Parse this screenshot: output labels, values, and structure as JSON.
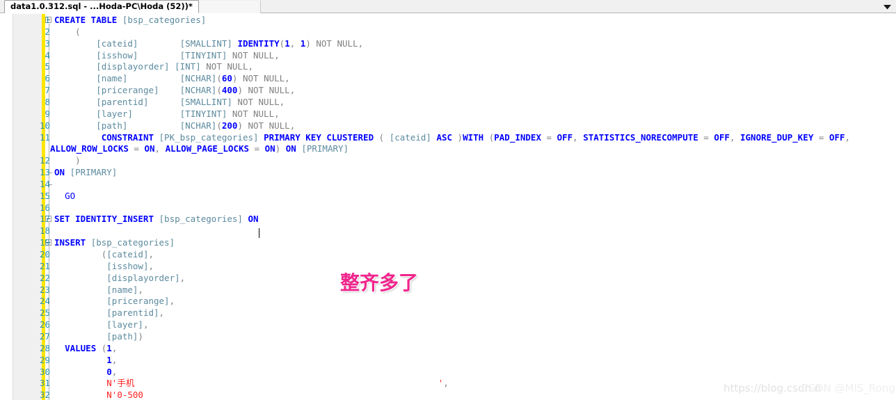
{
  "window": {
    "tab_title": "data1.0.312.sql - ...Hoda-PC\\Hoda (52))*",
    "tab_dropdown_icon": "chevron-down-icon"
  },
  "editor": {
    "language": "sql",
    "caret_line": 17,
    "first_visible_line": 1,
    "last_visible_line": 32,
    "colors": {
      "keyword": "#0000ff",
      "identifier": "#5b8a9e",
      "string": "#ff2020",
      "plain": "#808080",
      "line_number": "#2b91af",
      "change_bar": "#ffe600",
      "background": "#ffffff",
      "gutter": "#f0f0f0"
    },
    "lines": [
      {
        "n": 1,
        "fold": "start",
        "tokens": [
          {
            "t": "CREATE TABLE ",
            "c": "kw"
          },
          {
            "t": "[bsp_categories]",
            "c": "id"
          }
        ]
      },
      {
        "n": 2,
        "tokens": [
          {
            "t": "    (",
            "c": "pl"
          }
        ]
      },
      {
        "n": 3,
        "tokens": [
          {
            "t": "        ",
            "c": "pl"
          },
          {
            "t": "[cateid]",
            "c": "id"
          },
          {
            "t": "        ",
            "c": "pl"
          },
          {
            "t": "[SMALLINT]",
            "c": "id"
          },
          {
            "t": " ",
            "c": "pl"
          },
          {
            "t": "IDENTITY",
            "c": "kw"
          },
          {
            "t": "(",
            "c": "pl"
          },
          {
            "t": "1",
            "c": "num"
          },
          {
            "t": ", ",
            "c": "pl"
          },
          {
            "t": "1",
            "c": "num"
          },
          {
            "t": ") NOT NULL,",
            "c": "pl"
          }
        ]
      },
      {
        "n": 4,
        "tokens": [
          {
            "t": "        ",
            "c": "pl"
          },
          {
            "t": "[isshow]",
            "c": "id"
          },
          {
            "t": "        ",
            "c": "pl"
          },
          {
            "t": "[TINYINT]",
            "c": "id"
          },
          {
            "t": " NOT NULL,",
            "c": "pl"
          }
        ]
      },
      {
        "n": 5,
        "tokens": [
          {
            "t": "        ",
            "c": "pl"
          },
          {
            "t": "[displayorder]",
            "c": "id"
          },
          {
            "t": " ",
            "c": "pl"
          },
          {
            "t": "[INT]",
            "c": "id"
          },
          {
            "t": " NOT NULL,",
            "c": "pl"
          }
        ]
      },
      {
        "n": 6,
        "tokens": [
          {
            "t": "        ",
            "c": "pl"
          },
          {
            "t": "[name]",
            "c": "id"
          },
          {
            "t": "          ",
            "c": "pl"
          },
          {
            "t": "[NCHAR]",
            "c": "id"
          },
          {
            "t": "(",
            "c": "pl"
          },
          {
            "t": "60",
            "c": "num"
          },
          {
            "t": ") NOT NULL,",
            "c": "pl"
          }
        ]
      },
      {
        "n": 7,
        "tokens": [
          {
            "t": "        ",
            "c": "pl"
          },
          {
            "t": "[pricerange]",
            "c": "id"
          },
          {
            "t": "    ",
            "c": "pl"
          },
          {
            "t": "[NCHAR]",
            "c": "id"
          },
          {
            "t": "(",
            "c": "pl"
          },
          {
            "t": "400",
            "c": "num"
          },
          {
            "t": ") NOT NULL,",
            "c": "pl"
          }
        ]
      },
      {
        "n": 8,
        "tokens": [
          {
            "t": "        ",
            "c": "pl"
          },
          {
            "t": "[parentid]",
            "c": "id"
          },
          {
            "t": "      ",
            "c": "pl"
          },
          {
            "t": "[SMALLINT]",
            "c": "id"
          },
          {
            "t": " NOT NULL,",
            "c": "pl"
          }
        ]
      },
      {
        "n": 9,
        "tokens": [
          {
            "t": "        ",
            "c": "pl"
          },
          {
            "t": "[layer]",
            "c": "id"
          },
          {
            "t": "         ",
            "c": "pl"
          },
          {
            "t": "[TINYINT]",
            "c": "id"
          },
          {
            "t": " NOT NULL,",
            "c": "pl"
          }
        ]
      },
      {
        "n": 10,
        "tokens": [
          {
            "t": "        ",
            "c": "pl"
          },
          {
            "t": "[path]",
            "c": "id"
          },
          {
            "t": "          ",
            "c": "pl"
          },
          {
            "t": "[NCHAR]",
            "c": "id"
          },
          {
            "t": "(",
            "c": "pl"
          },
          {
            "t": "200",
            "c": "num"
          },
          {
            "t": ") NOT NULL,",
            "c": "pl"
          }
        ]
      },
      {
        "n": 11,
        "tokens": [
          {
            "t": "         ",
            "c": "pl"
          },
          {
            "t": "CONSTRAINT ",
            "c": "kw"
          },
          {
            "t": "[PK_bsp_categories]",
            "c": "id"
          },
          {
            "t": " ",
            "c": "pl"
          },
          {
            "t": "PRIMARY KEY CLUSTERED",
            "c": "kw"
          },
          {
            "t": " ( ",
            "c": "pl"
          },
          {
            "t": "[cateid]",
            "c": "id"
          },
          {
            "t": " ",
            "c": "pl"
          },
          {
            "t": "ASC",
            "c": "kw"
          },
          {
            "t": " )",
            "c": "pl"
          },
          {
            "t": "WITH",
            "c": "kw"
          },
          {
            "t": " (",
            "c": "pl"
          },
          {
            "t": "PAD_INDEX",
            "c": "kw"
          },
          {
            "t": " = ",
            "c": "pl"
          },
          {
            "t": "OFF",
            "c": "kw"
          },
          {
            "t": ", ",
            "c": "pl"
          },
          {
            "t": "STATISTICS_NORECOMPUTE",
            "c": "kw"
          },
          {
            "t": " = ",
            "c": "pl"
          },
          {
            "t": "OFF",
            "c": "kw"
          },
          {
            "t": ", ",
            "c": "pl"
          },
          {
            "t": "IGNORE_DUP_KEY",
            "c": "kw"
          },
          {
            "t": " = ",
            "c": "pl"
          },
          {
            "t": "OFF",
            "c": "kw"
          },
          {
            "t": ",",
            "c": "pl"
          }
        ]
      },
      {
        "n": null,
        "wrap": true,
        "tokens": [
          {
            "t": "ALLOW_ROW_LOCKS",
            "c": "kw"
          },
          {
            "t": " = ",
            "c": "pl"
          },
          {
            "t": "ON",
            "c": "kw"
          },
          {
            "t": ", ",
            "c": "pl"
          },
          {
            "t": "ALLOW_PAGE_LOCKS",
            "c": "kw"
          },
          {
            "t": " = ",
            "c": "pl"
          },
          {
            "t": "ON",
            "c": "kw"
          },
          {
            "t": ") ",
            "c": "pl"
          },
          {
            "t": "ON",
            "c": "kw"
          },
          {
            "t": " ",
            "c": "pl"
          },
          {
            "t": "[PRIMARY]",
            "c": "id"
          }
        ]
      },
      {
        "n": 12,
        "tokens": [
          {
            "t": "    )",
            "c": "pl"
          }
        ]
      },
      {
        "n": 13,
        "fold": "mid",
        "tokens": [
          {
            "t": "ON",
            "c": "kw"
          },
          {
            "t": " ",
            "c": "pl"
          },
          {
            "t": "[PRIMARY]",
            "c": "id"
          }
        ]
      },
      {
        "n": 14,
        "fold": "end",
        "tokens": [
          {
            "t": "",
            "c": "pl"
          }
        ]
      },
      {
        "n": 15,
        "tokens": [
          {
            "t": "  ",
            "c": "pl"
          },
          {
            "t": "GO",
            "c": "kw2"
          }
        ]
      },
      {
        "n": 16,
        "tokens": [
          {
            "t": "",
            "c": "pl"
          }
        ]
      },
      {
        "n": 17,
        "fold": "start",
        "tokens": [
          {
            "t": "SET IDENTITY_INSERT",
            "c": "kw"
          },
          {
            "t": " ",
            "c": "pl"
          },
          {
            "t": "[bsp_categories]",
            "c": "id"
          },
          {
            "t": " ",
            "c": "pl"
          },
          {
            "t": "ON",
            "c": "kw"
          }
        ]
      },
      {
        "n": 18,
        "tokens": [
          {
            "t": "",
            "c": "pl"
          }
        ]
      },
      {
        "n": 19,
        "fold": "start",
        "tokens": [
          {
            "t": "INSERT",
            "c": "kw"
          },
          {
            "t": " ",
            "c": "pl"
          },
          {
            "t": "[bsp_categories]",
            "c": "id"
          }
        ]
      },
      {
        "n": 20,
        "tokens": [
          {
            "t": "         (",
            "c": "pl"
          },
          {
            "t": "[cateid]",
            "c": "id"
          },
          {
            "t": ",",
            "c": "pl"
          }
        ]
      },
      {
        "n": 21,
        "tokens": [
          {
            "t": "          ",
            "c": "pl"
          },
          {
            "t": "[isshow]",
            "c": "id"
          },
          {
            "t": ",",
            "c": "pl"
          }
        ]
      },
      {
        "n": 22,
        "tokens": [
          {
            "t": "          ",
            "c": "pl"
          },
          {
            "t": "[displayorder]",
            "c": "id"
          },
          {
            "t": ",",
            "c": "pl"
          }
        ]
      },
      {
        "n": 23,
        "tokens": [
          {
            "t": "          ",
            "c": "pl"
          },
          {
            "t": "[name]",
            "c": "id"
          },
          {
            "t": ",",
            "c": "pl"
          }
        ]
      },
      {
        "n": 24,
        "tokens": [
          {
            "t": "          ",
            "c": "pl"
          },
          {
            "t": "[pricerange]",
            "c": "id"
          },
          {
            "t": ",",
            "c": "pl"
          }
        ]
      },
      {
        "n": 25,
        "tokens": [
          {
            "t": "          ",
            "c": "pl"
          },
          {
            "t": "[parentid]",
            "c": "id"
          },
          {
            "t": ",",
            "c": "pl"
          }
        ]
      },
      {
        "n": 26,
        "tokens": [
          {
            "t": "          ",
            "c": "pl"
          },
          {
            "t": "[layer]",
            "c": "id"
          },
          {
            "t": ",",
            "c": "pl"
          }
        ]
      },
      {
        "n": 27,
        "tokens": [
          {
            "t": "          ",
            "c": "pl"
          },
          {
            "t": "[path]",
            "c": "id"
          },
          {
            "t": ")",
            "c": "pl"
          }
        ]
      },
      {
        "n": 28,
        "tokens": [
          {
            "t": "  ",
            "c": "pl"
          },
          {
            "t": "VALUES",
            "c": "kw"
          },
          {
            "t": " (",
            "c": "pl"
          },
          {
            "t": "1",
            "c": "num"
          },
          {
            "t": ",",
            "c": "pl"
          }
        ]
      },
      {
        "n": 29,
        "tokens": [
          {
            "t": "          ",
            "c": "pl"
          },
          {
            "t": "1",
            "c": "num"
          },
          {
            "t": ",",
            "c": "pl"
          }
        ]
      },
      {
        "n": 30,
        "tokens": [
          {
            "t": "          ",
            "c": "pl"
          },
          {
            "t": "0",
            "c": "num"
          },
          {
            "t": ",",
            "c": "pl"
          }
        ]
      },
      {
        "n": 31,
        "tokens": [
          {
            "t": "          ",
            "c": "pl"
          },
          {
            "t": "N'手机                                                          '",
            "c": "str"
          },
          {
            "t": ",",
            "c": "pl"
          }
        ]
      },
      {
        "n": 32,
        "tokens": [
          {
            "t": "          ",
            "c": "pl"
          },
          {
            "t": "N'0-500",
            "c": "str"
          }
        ]
      }
    ]
  },
  "overlays": {
    "annotation_text": "整齐多了",
    "watermark_url": "https://blog.csdn.n",
    "watermark_tag": "CSDN @MIS_Rong"
  }
}
